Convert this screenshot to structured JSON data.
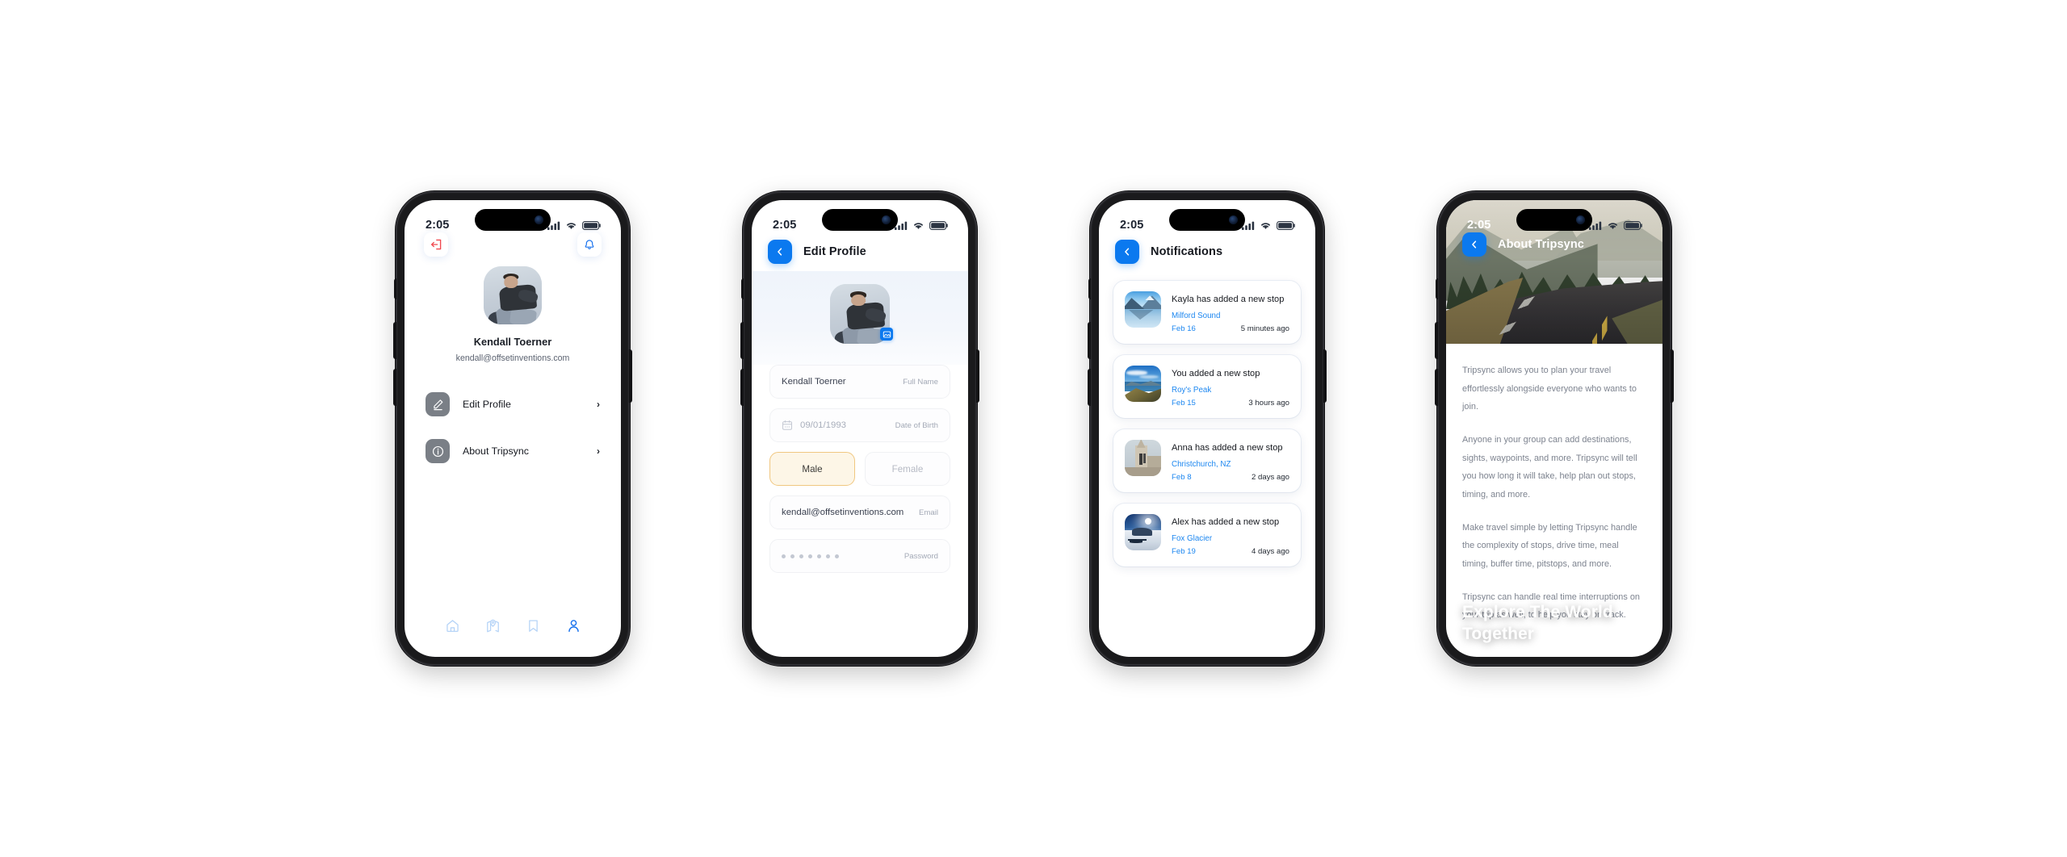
{
  "status_bar": {
    "time": "2:05",
    "signal_icon": "cellular-signal-icon",
    "wifi_icon": "wifi-icon",
    "battery_icon": "battery-icon"
  },
  "screen_profile": {
    "logout_icon": "logout-icon",
    "bell_icon": "bell-icon",
    "name": "Kendall Toerner",
    "email": "kendall@offsetinventions.com",
    "menu": [
      {
        "icon": "pencil-icon",
        "label": "Edit Profile",
        "chevron": "›"
      },
      {
        "icon": "info-icon",
        "label": "About Tripsync",
        "chevron": "›"
      }
    ],
    "tabs": [
      {
        "name": "home",
        "icon": "home-icon",
        "active": false
      },
      {
        "name": "explore",
        "icon": "map-pin-icon",
        "active": false
      },
      {
        "name": "saved",
        "icon": "bookmark-icon",
        "active": false
      },
      {
        "name": "profile",
        "icon": "person-icon",
        "active": true
      }
    ]
  },
  "screen_edit_profile": {
    "back_label": "‹",
    "title": "Edit Profile",
    "avatar_badge_icon": "image-edit-icon",
    "fields": [
      {
        "value": "Kendall Toerner",
        "label": "Full Name",
        "icon": null,
        "muted": false
      },
      {
        "value": "09/01/1993",
        "label": "Date of Birth",
        "icon": "calendar-icon",
        "muted": true
      },
      {
        "value": "kendall@offsetinventions.com",
        "label": "Email",
        "icon": null,
        "muted": false
      },
      {
        "value": "•••••••",
        "label": "Password",
        "icon": null,
        "muted": true
      }
    ],
    "gender": {
      "selected": "Male",
      "options": [
        "Male",
        "Female"
      ]
    }
  },
  "screen_notifications": {
    "back_label": "‹",
    "title": "Notifications",
    "items": [
      {
        "title": "Kayla has added a new stop",
        "place": "Milford Sound",
        "date": "Feb 16",
        "ago": "5 minutes ago",
        "thumb": "milford-sound-thumbnail"
      },
      {
        "title": "You added a new stop",
        "place": "Roy's Peak",
        "date": "Feb 15",
        "ago": "3 hours ago",
        "thumb": "roys-peak-thumbnail"
      },
      {
        "title": "Anna has added a new stop",
        "place": "Christchurch, NZ",
        "date": "Feb 8",
        "ago": "2 days ago",
        "thumb": "christchurch-thumbnail"
      },
      {
        "title": "Alex has added a new stop",
        "place": "Fox Glacier",
        "date": "Feb 19",
        "ago": "4 days ago",
        "thumb": "fox-glacier-thumbnail"
      }
    ]
  },
  "screen_about": {
    "back_label": "‹",
    "title": "About Tripsync",
    "heading": "Explore The World Together",
    "paragraphs": [
      "Tripsync allows you to plan your travel effortlessly alongside everyone who wants to join.",
      "Anyone in your group can add destinations, sights, waypoints, and more. Tripsync will tell you how long it will take, help plan out stops, timing, and more.",
      "Make travel simple by letting Tripsync handle the complexity of stops, drive time, meal timing, buffer time, pitstops, and more.",
      "Tripsync can handle real time interruptions on your trip as well, to help you stay on track."
    ]
  },
  "colors": {
    "accent_blue": "#0b79ef",
    "link_blue": "#1d87f0",
    "logout_red": "#f0484e",
    "selected_amber_border": "#f0c780",
    "selected_amber_bg": "#fdf6e7"
  }
}
